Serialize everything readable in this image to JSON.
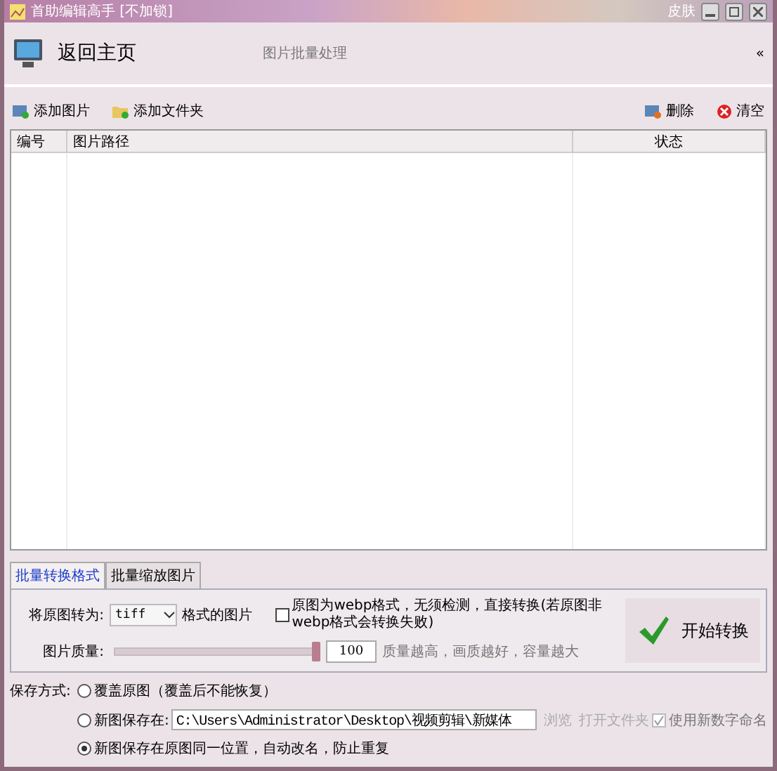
{
  "window": {
    "title": "首助编辑高手 [不加锁]",
    "skin": "皮肤"
  },
  "header": {
    "home": "返回主页",
    "subtitle": "图片批量处理",
    "collapse": "«"
  },
  "toolbar": {
    "left": [
      {
        "label": "添加图片",
        "kind": "add-image"
      },
      {
        "label": "添加文件夹",
        "kind": "add-folder"
      }
    ],
    "right": [
      {
        "label": "删除",
        "kind": "delete"
      },
      {
        "label": "清空",
        "kind": "clear"
      }
    ]
  },
  "table": {
    "columns": [
      "编号",
      "图片路径",
      "状态"
    ]
  },
  "tabs": [
    {
      "label": "批量转换格式",
      "selected": true
    },
    {
      "label": "批量缩放图片",
      "selected": false
    }
  ],
  "convert": {
    "label": "将原图转为:",
    "format": "tiff",
    "suffix": "格式的图片",
    "webp_checked": false,
    "webp_label": "原图为webp格式，无须检测，直接转换(若原图非webp格式会转换失败)",
    "quality_label": "图片质量:",
    "level": 1,
    "quality_value": "100",
    "quality_hint": "质量越高，画质越好，容量越大",
    "start": "开始转换"
  },
  "save": {
    "label": "保存方式:",
    "options": [
      {
        "label": "覆盖原图（覆盖后不能恢复）",
        "selected": false
      },
      {
        "label": "新图保存在:",
        "selected": false,
        "path": "C:\\Users\\Administrator\\Desktop\\视频剪辑\\新媒体",
        "browse": "浏览",
        "open_folder": "打开文件夹",
        "numbering_label": "使用新数字命名",
        "numbering_checked": true
      },
      {
        "label": "新图保存在原图同一位置，自动改名，防止重复",
        "selected": true
      }
    ]
  }
}
